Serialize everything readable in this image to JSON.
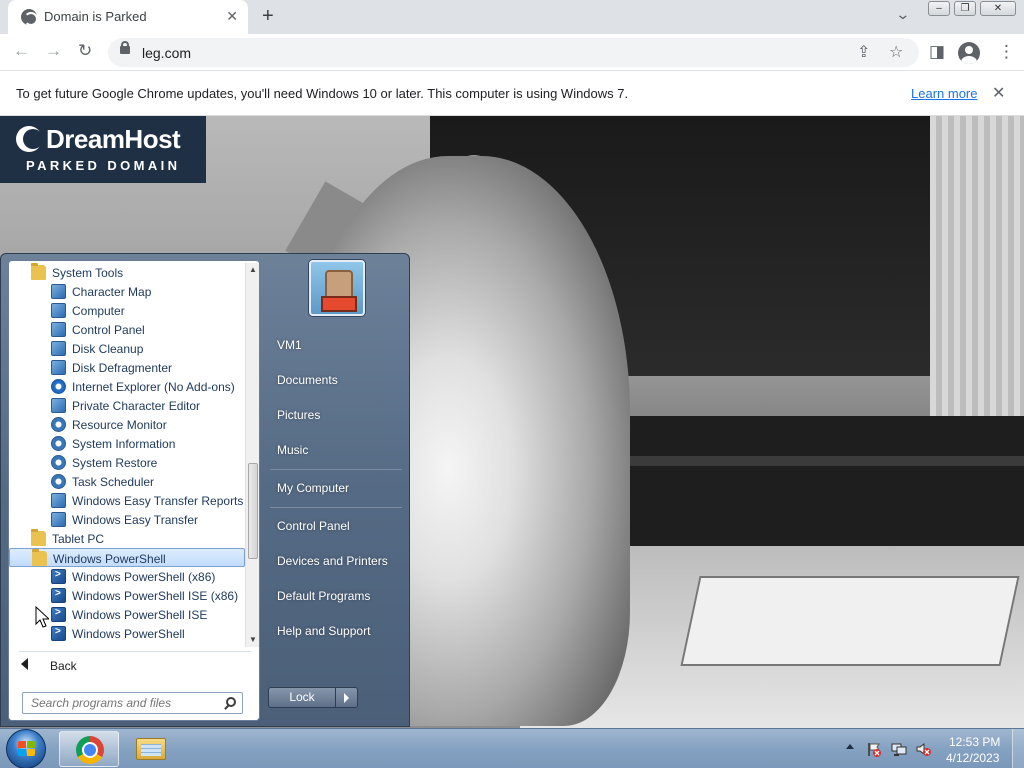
{
  "browser": {
    "tab_title": "Domain is Parked",
    "url": "leg.com",
    "infobar_text": "To get future Google Chrome updates, you'll need Windows 10 or later. This computer is using Windows 7.",
    "infobar_link": "Learn more"
  },
  "page": {
    "logo_name": "DreamHost",
    "logo_sub": "PARKED DOMAIN"
  },
  "start_menu": {
    "programs": [
      {
        "label": "System Tools",
        "kind": "folder",
        "icon": "folder-icon"
      },
      {
        "label": "Character Map",
        "kind": "app",
        "icon": "character-map-icon"
      },
      {
        "label": "Computer",
        "kind": "app",
        "icon": "computer-icon"
      },
      {
        "label": "Control Panel",
        "kind": "app",
        "icon": "control-panel-icon"
      },
      {
        "label": "Disk Cleanup",
        "kind": "app",
        "icon": "disk-cleanup-icon"
      },
      {
        "label": "Disk Defragmenter",
        "kind": "app",
        "icon": "disk-defragmenter-icon"
      },
      {
        "label": "Internet Explorer (No Add-ons)",
        "kind": "app",
        "icon": "internet-explorer-icon"
      },
      {
        "label": "Private Character Editor",
        "kind": "app",
        "icon": "private-character-editor-icon"
      },
      {
        "label": "Resource Monitor",
        "kind": "app",
        "icon": "resource-monitor-icon"
      },
      {
        "label": "System Information",
        "kind": "app",
        "icon": "system-information-icon"
      },
      {
        "label": "System Restore",
        "kind": "app",
        "icon": "system-restore-icon"
      },
      {
        "label": "Task Scheduler",
        "kind": "app",
        "icon": "task-scheduler-icon"
      },
      {
        "label": "Windows Easy Transfer Reports",
        "kind": "app",
        "icon": "easy-transfer-reports-icon"
      },
      {
        "label": "Windows Easy Transfer",
        "kind": "app",
        "icon": "easy-transfer-icon"
      },
      {
        "label": "Tablet PC",
        "kind": "folder",
        "icon": "folder-icon"
      },
      {
        "label": "Windows PowerShell",
        "kind": "folder",
        "icon": "folder-icon",
        "selected": true
      },
      {
        "label": "Windows PowerShell (x86)",
        "kind": "app",
        "icon": "powershell-icon"
      },
      {
        "label": "Windows PowerShell ISE (x86)",
        "kind": "app",
        "icon": "powershell-ise-icon"
      },
      {
        "label": "Windows PowerShell ISE",
        "kind": "app",
        "icon": "powershell-ise-icon"
      },
      {
        "label": "Windows PowerShell",
        "kind": "app",
        "icon": "powershell-icon"
      }
    ],
    "back_label": "Back",
    "search_placeholder": "Search programs and files",
    "right_items": {
      "user": "VM1",
      "documents": "Documents",
      "pictures": "Pictures",
      "music": "Music",
      "my_computer": "My Computer",
      "control_panel": "Control Panel",
      "devices_printers": "Devices and Printers",
      "default_programs": "Default Programs",
      "help_support": "Help and Support"
    },
    "lock_label": "Lock"
  },
  "taskbar": {
    "time": "12:53 PM",
    "date": "4/12/2023"
  }
}
